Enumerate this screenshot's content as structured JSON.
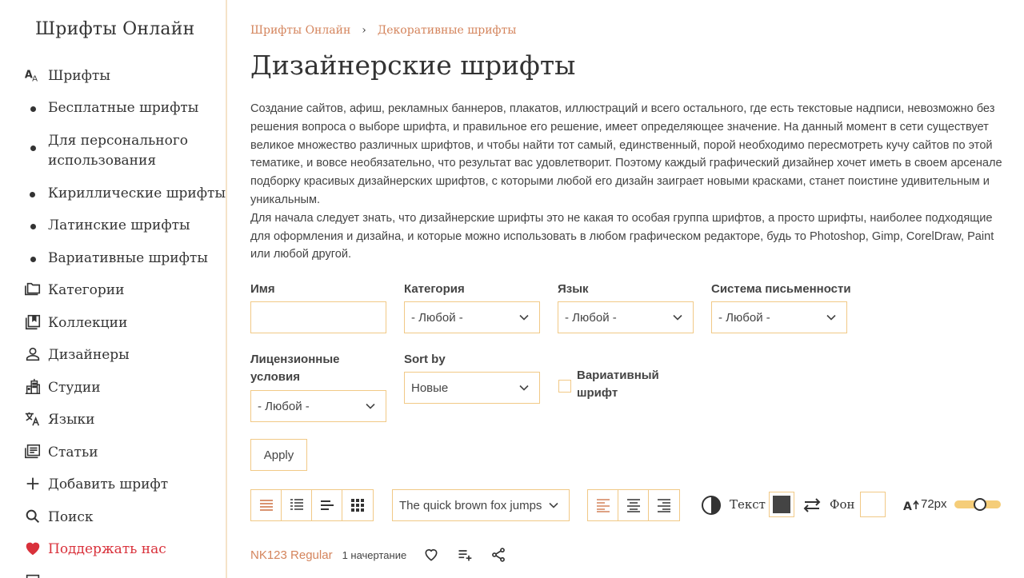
{
  "brand": "Шрифты Онлайн",
  "sidebar": {
    "items": [
      {
        "label": "Шрифты",
        "icon": "font-icon"
      },
      {
        "label": "Бесплатные шрифты",
        "icon": "bullet-icon"
      },
      {
        "label": "Для персонального использования",
        "icon": "bullet-icon"
      },
      {
        "label": "Кириллические шрифты",
        "icon": "bullet-icon"
      },
      {
        "label": "Латинские шрифты",
        "icon": "bullet-icon"
      },
      {
        "label": "Вариативные шрифты",
        "icon": "bullet-icon"
      },
      {
        "label": "Категории",
        "icon": "folder-icon"
      },
      {
        "label": "Коллекции",
        "icon": "collection-icon"
      },
      {
        "label": "Дизайнеры",
        "icon": "person-icon"
      },
      {
        "label": "Студии",
        "icon": "building-icon"
      },
      {
        "label": "Языки",
        "icon": "translate-icon"
      },
      {
        "label": "Статьи",
        "icon": "article-icon"
      },
      {
        "label": "Добавить шрифт",
        "icon": "plus-icon"
      },
      {
        "label": "Поиск",
        "icon": "search-icon"
      },
      {
        "label": "Поддержать нас",
        "icon": "heart-icon"
      }
    ]
  },
  "breadcrumb": {
    "items": [
      "Шрифты Онлайн",
      "Декоративные шрифты"
    ],
    "separator": "›"
  },
  "page_title": "Дизайнерские шрифты",
  "description": {
    "p1": "Создание сайтов, афиш, рекламных баннеров, плакатов, иллюстраций и всего остального, где есть текстовые надписи, невозможно без решения вопроса о выборе шрифта, и правильное его решение, имеет определяющее значение. На данный момент в сети существует великое множество различных шрифтов, и чтобы найти тот самый, единственный, порой необходимо пересмотреть кучу сайтов по этой тематике, и вовсе необязательно, что результат вас удовлетворит. Поэтому каждый графический дизайнер хочет иметь в своем арсенале подборку красивых дизайнерских шрифтов, с которыми любой его дизайн заиграет новыми красками, станет поистине удивительным и уникальным.",
    "p2": "Для начала следует знать, что дизайнерские шрифты это не какая то особая группа шрифтов, а просто шрифты, наиболее подходящие для оформления и дизайна, и которые можно использовать в любом графическом редакторе, будь то Photoshop, Gimp, CorelDraw, Paint или любой другой."
  },
  "filters": {
    "name_label": "Имя",
    "name_value": "",
    "category_label": "Категория",
    "category_value": "- Любой -",
    "language_label": "Язык",
    "language_value": "- Любой -",
    "script_label": "Система письменности",
    "script_value": "- Любой -",
    "license_label": "Лицензионные условия",
    "license_value": "- Любой -",
    "sort_label": "Sort by",
    "sort_value": "Новые",
    "variable_label": "Вариативный шрифт",
    "variable_checked": false,
    "apply_label": "Apply"
  },
  "toolbar": {
    "view_modes": [
      "list-view-icon",
      "detailed-list-icon",
      "compact-list-icon",
      "grid-view-icon"
    ],
    "preview_text": "The quick brown fox jumps",
    "align_modes": [
      "align-left-icon",
      "align-center-icon",
      "align-right-icon"
    ],
    "text_label": "Текст",
    "text_color": "#444444",
    "bg_label": "Фон",
    "bg_color": "#ffffff",
    "size_label": "72px",
    "size_value": 72
  },
  "font_item": {
    "name": "NK123 Regular",
    "styles_count": "1 начертание"
  },
  "colors": {
    "accent": "#d4845c",
    "border": "#f1c986",
    "support": "#d9313b"
  }
}
